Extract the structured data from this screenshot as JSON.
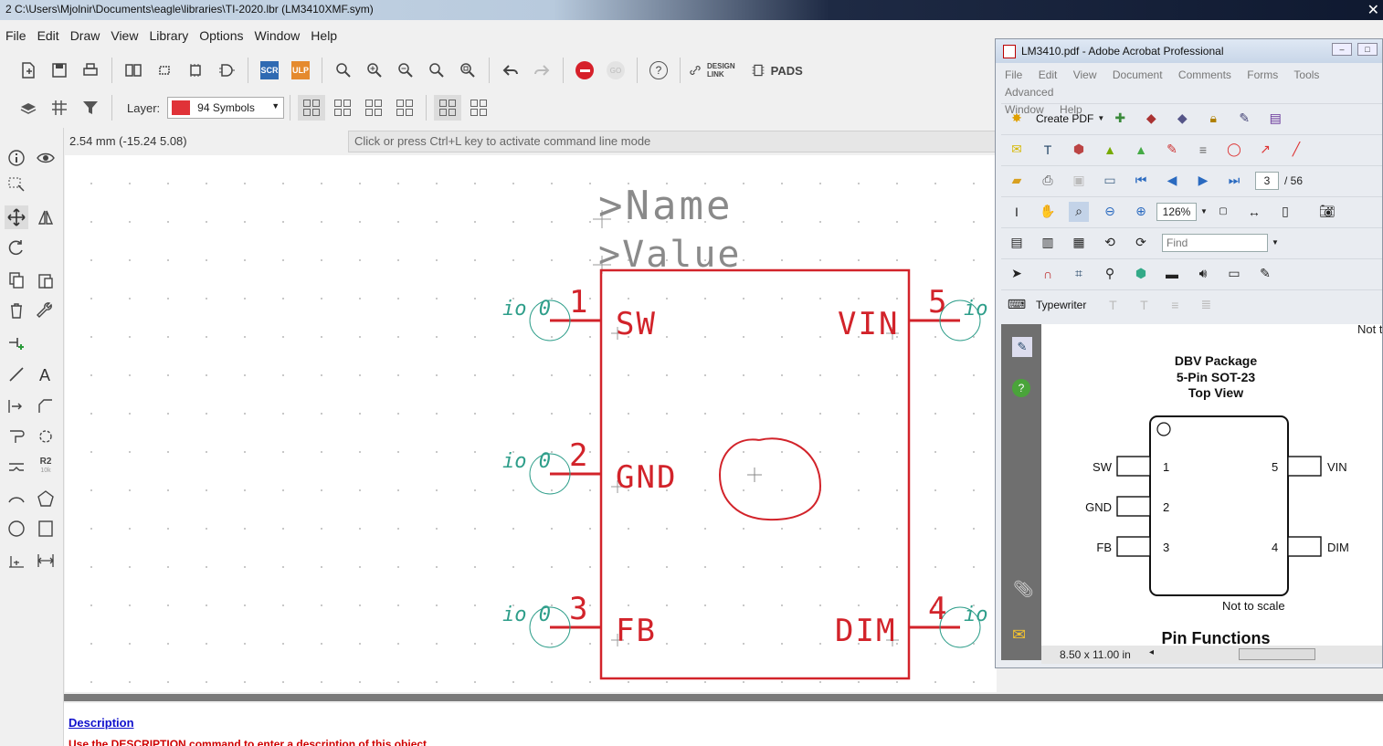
{
  "window": {
    "title": "2 C:\\Users\\Mjolnir\\Documents\\eagle\\libraries\\TI-2020.lbr (LM3410XMF.sym)"
  },
  "menu": [
    "File",
    "Edit",
    "Draw",
    "View",
    "Library",
    "Options",
    "Window",
    "Help"
  ],
  "toolbar": {
    "scr_label": "SCR",
    "ulp_label": "ULP",
    "go_label": "GO",
    "help_label": "?",
    "design_link": "DESIGN\nLINK",
    "pads_label": "PADS"
  },
  "layer": {
    "label": "Layer:",
    "value": "94 Symbols",
    "color": "#e03238"
  },
  "status": {
    "coordinates": "2.54 mm (-15.24 5.08)",
    "command_placeholder": "Click or press Ctrl+L key to activate command line mode"
  },
  "left_tools": {
    "r2_label": "R2",
    "r2_sub": "10k"
  },
  "symbol": {
    "name_placeholder": ">Name",
    "value_placeholder": ">Value",
    "pins": [
      {
        "number": "1",
        "name": "SW",
        "io": "io 0"
      },
      {
        "number": "2",
        "name": "GND",
        "io": "io 0"
      },
      {
        "number": "3",
        "name": "FB",
        "io": "io 0"
      },
      {
        "number": "5",
        "name": "VIN",
        "io": "io"
      },
      {
        "number": "4",
        "name": "DIM",
        "io": "io"
      }
    ],
    "symbol_color": "#d2232a",
    "pin_color": "#2e9e8a"
  },
  "description": {
    "heading": "Description",
    "text": "Use the DESCRIPTION command to enter a description of this object"
  },
  "acrobat": {
    "title": "LM3410.pdf - Adobe Acrobat Professional",
    "menu": [
      "File",
      "Edit",
      "View",
      "Document",
      "Comments",
      "Forms",
      "Tools",
      "Advanced",
      "Window",
      "Help"
    ],
    "create_pdf": "Create PDF",
    "page_current": "3",
    "page_total": "/ 56",
    "zoom": "126%",
    "find_placeholder": "Find",
    "typewriter": "Typewriter",
    "page_size": "8.50 x 11.00 in",
    "doc": {
      "top_clip": "Not to",
      "package_line1": "DBV Package",
      "package_line2": "5-Pin SOT-23",
      "package_line3": "Top View",
      "left_pins": [
        {
          "name": "SW",
          "num": "1"
        },
        {
          "name": "GND",
          "num": "2"
        },
        {
          "name": "FB",
          "num": "3"
        }
      ],
      "right_pins": [
        {
          "name": "VIN",
          "num": "5"
        },
        {
          "name": "DIM",
          "num": "4"
        }
      ],
      "not_to_scale": "Not to scale",
      "section_heading": "Pin Functions"
    }
  }
}
